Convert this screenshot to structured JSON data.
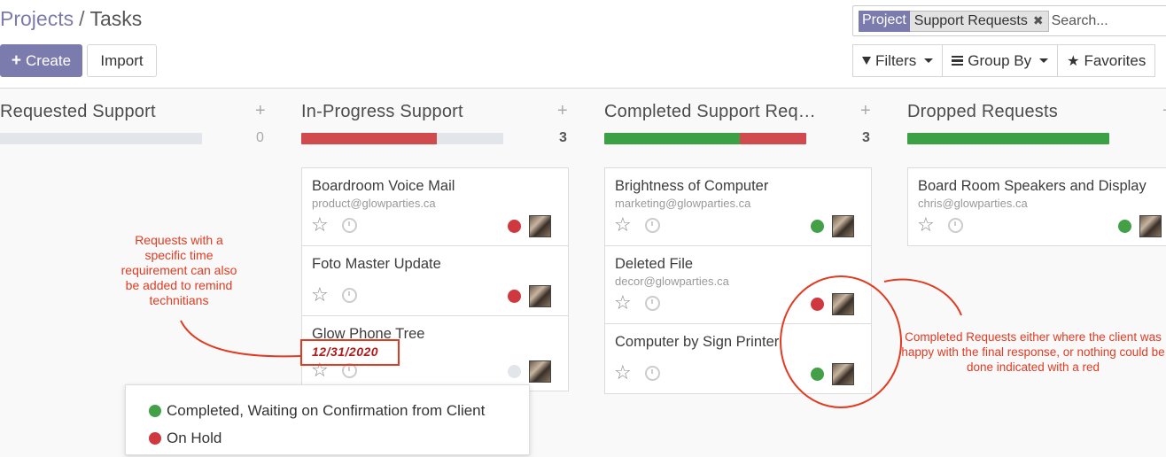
{
  "breadcrumb": {
    "parent": "Projects",
    "separator": "/",
    "current": "Tasks"
  },
  "toolbar": {
    "create_label": "Create",
    "import_label": "Import"
  },
  "search": {
    "facet_category": "Project",
    "facet_value": "Support Requests",
    "placeholder": "Search..."
  },
  "filters": {
    "filters_label": "Filters",
    "groupby_label": "Group By",
    "favorites_label": "Favorites"
  },
  "colors": {
    "brand": "#7c7bad",
    "red": "#d0383f",
    "green": "#43a047",
    "annotation": "#e23b22"
  },
  "columns": [
    {
      "title": "Requested Support",
      "count": "0",
      "progress": {
        "green": 0,
        "red": 0
      }
    },
    {
      "title": "In-Progress Support",
      "count": "3",
      "progress": {
        "green": 0,
        "red": 0.67
      }
    },
    {
      "title": "Completed Support Req…",
      "count": "3",
      "progress": {
        "green": 0.67,
        "red": 0.33
      }
    },
    {
      "title": "Dropped Requests",
      "count": "",
      "progress": {
        "green": 1,
        "red": 0
      }
    }
  ],
  "cards": {
    "inprogress": [
      {
        "title": "Boardroom Voice Mail",
        "email": "product@glowparties.ca",
        "status": "red"
      },
      {
        "title": "Foto Master Update",
        "email": "",
        "status": "red"
      },
      {
        "title": "Glow Phone Tree",
        "email": "",
        "date": "12/31/2020",
        "status": "grey"
      }
    ],
    "completed": [
      {
        "title": "Brightness of Computer",
        "email": "marketing@glowparties.ca",
        "status": "green"
      },
      {
        "title": "Deleted File",
        "email": "decor@glowparties.ca",
        "status": "red"
      },
      {
        "title": "Computer by Sign Printer",
        "email": "",
        "status": "green"
      }
    ],
    "dropped": [
      {
        "title": "Board Room Speakers and Display",
        "email": "chris@glowparties.ca",
        "status": "green"
      }
    ]
  },
  "annotations": {
    "time_note": "Requests with a specific time requirement can also be added to remind technitians",
    "completed_note": "Completed Requests either where the client was happy with the final response, or nothing could be done indicated with a red"
  },
  "legend": [
    {
      "label": "Completed, Waiting on Confirmation from Client",
      "color": "#43a047"
    },
    {
      "label": "On Hold",
      "color": "#d0383f"
    }
  ]
}
